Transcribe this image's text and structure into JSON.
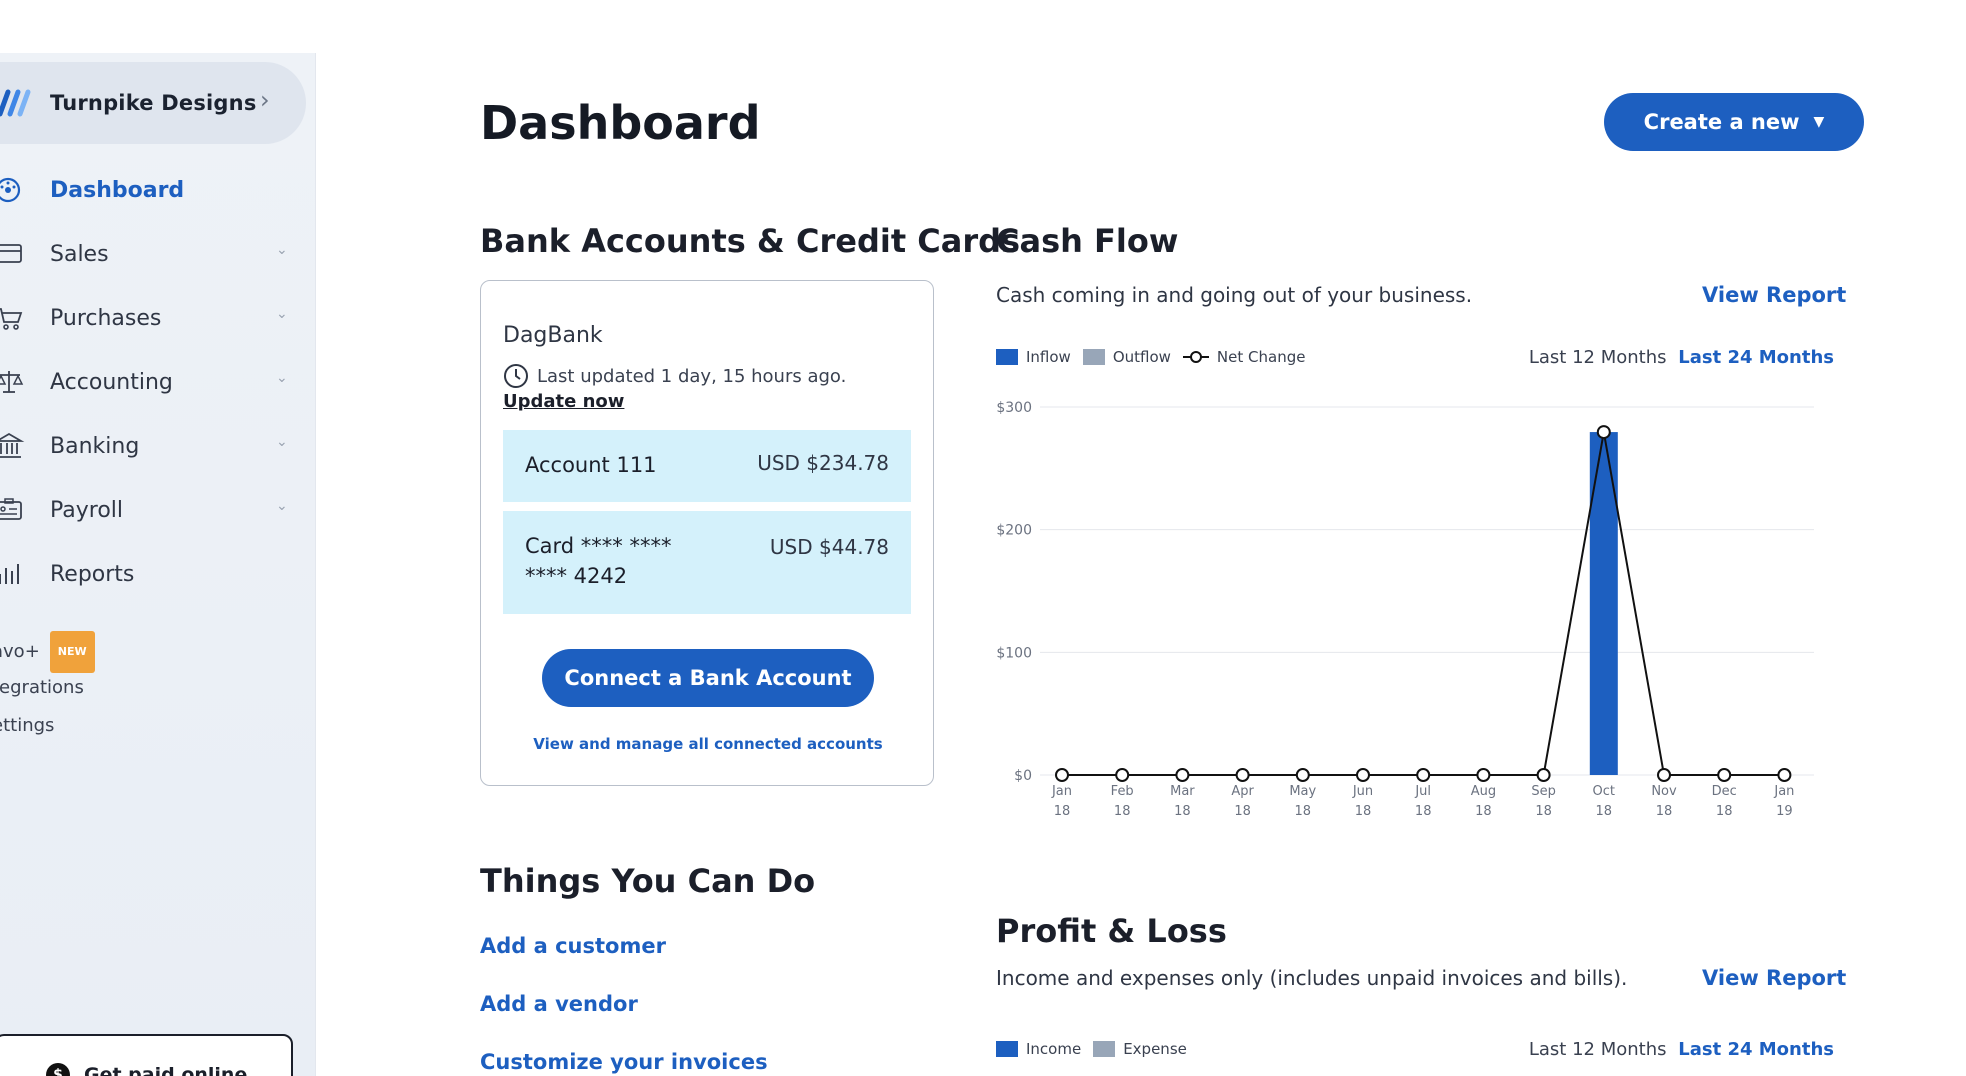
{
  "sidebar": {
    "org_name": "Turnpike Designs",
    "items": [
      {
        "label": "Dashboard",
        "icon": "dashboard-icon",
        "active": true
      },
      {
        "label": "Sales",
        "icon": "credit-card-icon"
      },
      {
        "label": "Purchases",
        "icon": "cart-icon"
      },
      {
        "label": "Accounting",
        "icon": "scale-icon"
      },
      {
        "label": "Banking",
        "icon": "bank-icon"
      },
      {
        "label": "Payroll",
        "icon": "id-card-icon"
      },
      {
        "label": "Reports",
        "icon": "bar-chart-icon"
      }
    ],
    "extras": [
      "avo+",
      "tegrations",
      "ettings"
    ],
    "new_badge": "NEW",
    "get_paid_label": "Get paid online"
  },
  "header": {
    "title": "Dashboard",
    "create_label": "Create a new"
  },
  "bank": {
    "heading": "Bank Accounts & Credit Cards",
    "bank_name": "DagBank",
    "last_updated": "Last updated 1 day, 15 hours ago.",
    "update_link": "Update now",
    "accounts": [
      {
        "name": "Account 111",
        "amount": "USD $234.78"
      },
      {
        "name": "Card **** **** **** 4242",
        "amount": "USD $44.78"
      }
    ],
    "connect_label": "Connect a Bank Account",
    "manage_link": "View and manage all connected accounts"
  },
  "todo": {
    "heading": "Things You Can Do",
    "links": [
      "Add a customer",
      "Add a vendor",
      "Customize your invoices"
    ]
  },
  "cashflow": {
    "heading": "Cash Flow",
    "subtitle": "Cash coming in and going out of your business.",
    "view_report": "View Report",
    "legend": [
      "Inflow",
      "Outflow",
      "Net Change"
    ],
    "range_a": "Last 12 Months",
    "range_b": "Last 24 Months"
  },
  "pnl": {
    "heading": "Profit & Loss",
    "subtitle": "Income and expenses only (includes unpaid invoices and bills).",
    "view_report": "View Report",
    "legend": [
      "Income",
      "Expense"
    ],
    "range_a": "Last 12 Months",
    "range_b": "Last 24 Months"
  },
  "colors": {
    "accent": "#1d5fc0",
    "inflow": "#1d5fc0",
    "outflow": "#98a6b8",
    "account_bg": "#d4f1fb",
    "new_badge": "#f0a23b"
  },
  "chart_data": {
    "type": "bar",
    "categories": [
      "Jan 18",
      "Feb 18",
      "Mar 18",
      "Apr 18",
      "May 18",
      "Jun 18",
      "Jul 18",
      "Aug 18",
      "Sep 18",
      "Oct 18",
      "Nov 18",
      "Dec 18",
      "Jan 19"
    ],
    "series": [
      {
        "name": "Inflow",
        "values": [
          0,
          0,
          0,
          0,
          0,
          0,
          0,
          0,
          0,
          279.56,
          0,
          0,
          0
        ]
      },
      {
        "name": "Outflow",
        "values": [
          0,
          0,
          0,
          0,
          0,
          0,
          0,
          0,
          0,
          0,
          0,
          0,
          0
        ]
      },
      {
        "name": "Net Change",
        "values": [
          0,
          0,
          0,
          0,
          0,
          0,
          0,
          0,
          0,
          279.56,
          0,
          0,
          0
        ]
      }
    ],
    "yticks": [
      "$300",
      "$200",
      "$100",
      "$0"
    ],
    "ylim": [
      0,
      300
    ],
    "grid": true
  }
}
